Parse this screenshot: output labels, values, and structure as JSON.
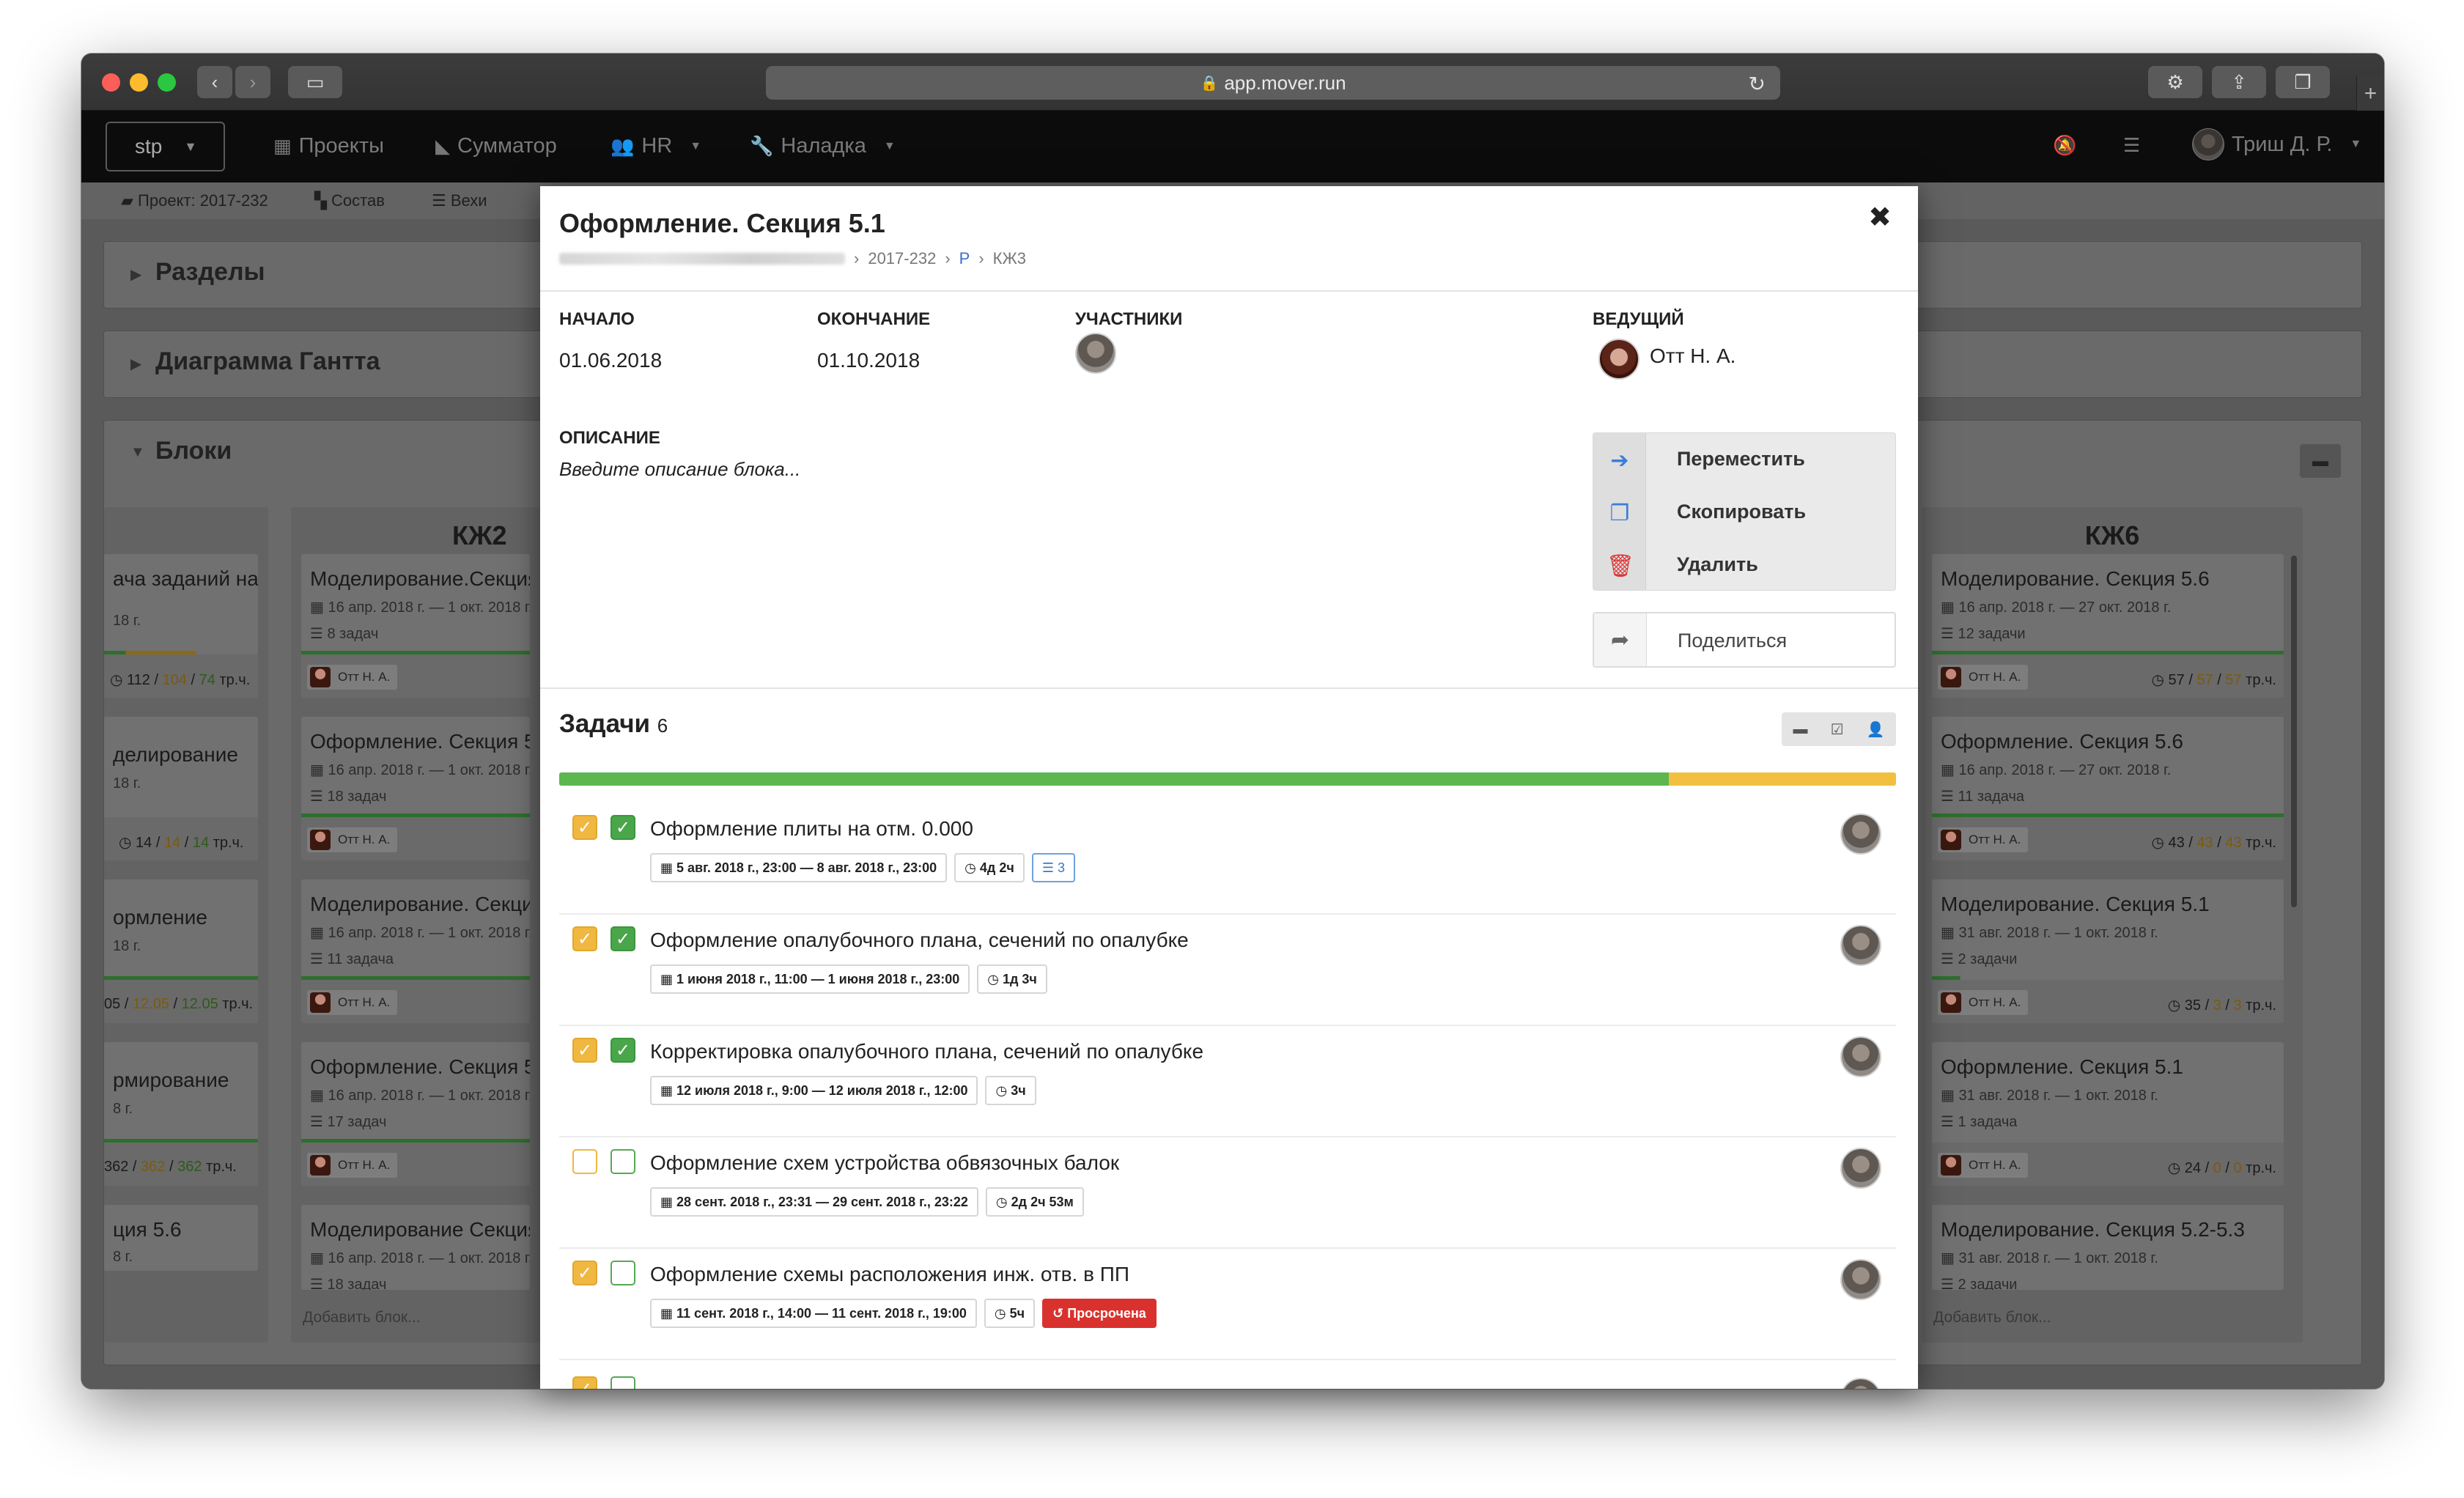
{
  "browser": {
    "url": "app.mover.run"
  },
  "navbar": {
    "project_select": "stp",
    "items": [
      {
        "label": "Проекты"
      },
      {
        "label": "Сумматор"
      },
      {
        "label": "HR"
      },
      {
        "label": "Наладка"
      }
    ],
    "user": "Триш Д. Р."
  },
  "subnav": {
    "items": [
      "Проект: 2017-232",
      "Состав",
      "Вехи"
    ]
  },
  "panels": {
    "sections": "Разделы",
    "gantt": "Диаграмма Гантта",
    "blocks": "Блоки"
  },
  "board": {
    "left_cards": [
      {
        "title": "ача заданий на",
        "date": "18 г.",
        "cost": [
          "112",
          "104",
          "74",
          "тр.ч."
        ]
      },
      {
        "title": "делирование",
        "date": "18 г.",
        "cost": [
          "14",
          "14",
          "14",
          "тр.ч."
        ]
      },
      {
        "title": "ормление",
        "date": "18 г.",
        "cost": [
          "05",
          "12.05",
          "12.05",
          "тр.ч."
        ]
      },
      {
        "title": "рмирование",
        "date": "8 г.",
        "cost": [
          "362",
          "362",
          "362",
          "тр.ч."
        ]
      },
      {
        "title": "ция 5.6",
        "date": "8 г."
      }
    ],
    "kzh2": {
      "title": "КЖ2",
      "cards": [
        {
          "title": "Моделирование.Секция",
          "date": "16 апр. 2018 г. — 1 окт. 2018 г.",
          "count": "8 задач",
          "owner": "Отт Н. А."
        },
        {
          "title": "Оформление. Секция 5.",
          "date": "16 апр. 2018 г. — 1 окт. 2018 г.",
          "count": "18 задач",
          "owner": "Отт Н. А."
        },
        {
          "title": "Моделирование. Секци",
          "date": "16 апр. 2018 г. — 1 окт. 2018 г.",
          "count": "11 задача",
          "owner": "Отт Н. А."
        },
        {
          "title": "Оформление. Секция 5.",
          "date": "16 апр. 2018 г. — 1 окт. 2018 г.",
          "count": "17 задач",
          "owner": "Отт Н. А."
        },
        {
          "title": "Моделирование Секция",
          "date": "16 апр. 2018 г. — 1 окт. 2018 г.",
          "count": "18 задач"
        }
      ],
      "add": "Добавить блок..."
    },
    "kzh6": {
      "title": "КЖ6",
      "cards": [
        {
          "title": "Моделирование. Секция 5.6",
          "date": "16 апр. 2018 г. — 27 окт. 2018 г.",
          "count": "12 задачи",
          "owner": "Отт Н. А.",
          "cost": [
            "57",
            "57",
            "57",
            "тр.ч."
          ]
        },
        {
          "title": "Оформление. Секция 5.6",
          "date": "16 апр. 2018 г. — 27 окт. 2018 г.",
          "count": "11 задача",
          "owner": "Отт Н. А.",
          "cost": [
            "43",
            "43",
            "43",
            "тр.ч."
          ]
        },
        {
          "title": "Моделирование. Секция 5.1",
          "date": "31 авг. 2018 г. — 1 окт. 2018 г.",
          "count": "2 задачи",
          "owner": "Отт Н. А.",
          "cost": [
            "35",
            "3",
            "3",
            "тр.ч."
          ]
        },
        {
          "title": "Оформление. Секция 5.1",
          "date": "31 авг. 2018 г. — 1 окт. 2018 г.",
          "count": "1 задача",
          "owner": "Отт Н. А.",
          "cost": [
            "24",
            "0",
            "0",
            "тр.ч."
          ]
        },
        {
          "title": "Моделирование. Секция 5.2-5.3",
          "date": "31 авг. 2018 г. — 1 окт. 2018 г.",
          "count": "2 задачи"
        }
      ],
      "add": "Добавить блок..."
    }
  },
  "modal": {
    "title": "Оформление. Секция 5.1",
    "breadcrumb": [
      "2017-232",
      "Р",
      "КЖ3"
    ],
    "start_label": "НАЧАЛО",
    "start_value": "01.06.2018",
    "end_label": "ОКОНЧАНИЕ",
    "end_value": "01.10.2018",
    "participants_label": "УЧАСТНИКИ",
    "lead_label": "ВЕДУЩИЙ",
    "lead_name": "Отт Н. А.",
    "description_label": "ОПИСАНИЕ",
    "description_placeholder": "Введите описание блока...",
    "actions": {
      "move": "Переместить",
      "copy": "Скопировать",
      "delete": "Удалить"
    },
    "share": "Поделиться",
    "tasks_title": "Задачи",
    "tasks_count": "6",
    "progress_fraction": 0.83,
    "tasks": [
      {
        "title": "Оформление плиты на отм. 0.000",
        "dates": "5 авг. 2018 г., 23:00 — 8 авг. 2018 г., 23:00",
        "duration": "4д 2ч",
        "subtasks": "3",
        "yellow": true,
        "green": true
      },
      {
        "title": "Оформление опалубочного плана, сечений по опалубке",
        "dates": "1 июня 2018 г., 11:00 — 1 июня 2018 г., 23:00",
        "duration": "1д 3ч",
        "yellow": true,
        "green": true
      },
      {
        "title": "Корректировка опалубочного плана, сечений по опалубке",
        "dates": "12 июля 2018 г., 9:00 — 12 июля 2018 г., 12:00",
        "duration": "3ч",
        "yellow": true,
        "green": true
      },
      {
        "title": "Оформление схем устройства обвязочных балок",
        "dates": "28 сент. 2018 г., 23:31 — 29 сент. 2018 г., 23:22",
        "duration": "2д 2ч 53м",
        "yellow": false,
        "green": false
      },
      {
        "title": "Оформление схемы расположения инж. отв. в ПП",
        "dates": "11 сент. 2018 г., 14:00 — 11 сент. 2018 г., 19:00",
        "duration": "5ч",
        "overdue": "Просрочена",
        "yellow": true,
        "green": false
      }
    ]
  },
  "colors": {
    "progress_done": "#5cb84e",
    "progress_rest": "#f1c040",
    "overdue": "#d9322e",
    "link": "#3a6ed0"
  }
}
